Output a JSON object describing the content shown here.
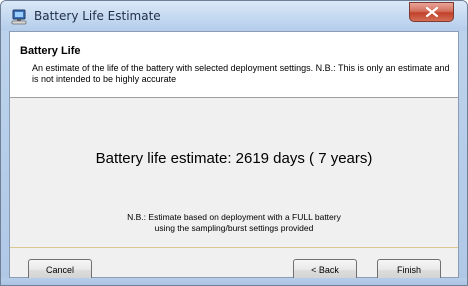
{
  "window": {
    "title": "Battery Life Estimate"
  },
  "header": {
    "title": "Battery Life",
    "description": "An estimate of the life of the battery with selected deployment settings. N.B.: This is only an estimate and is not intended to be highly accurate"
  },
  "main": {
    "estimate_text": "Battery life estimate: 2619 days ( 7 years)",
    "note_line1": "N.B.: Estimate based on deployment with a FULL battery",
    "note_line2": "using the sampling/burst settings provided"
  },
  "buttons": {
    "cancel": "Cancel",
    "back": "< Back",
    "finish": "Finish"
  },
  "icons": {
    "app": "computer-icon",
    "close": "close-icon"
  }
}
